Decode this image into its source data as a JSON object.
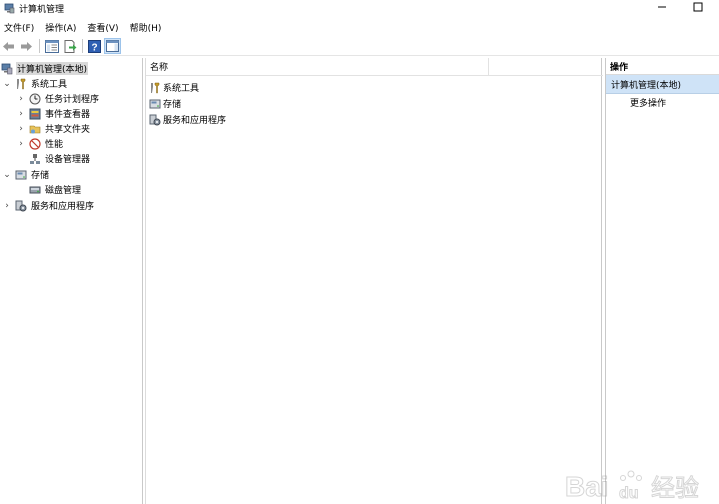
{
  "window": {
    "title": "计算机管理",
    "minimize_glyph": "—",
    "maximize_glyph": "☐"
  },
  "menu": {
    "items": [
      {
        "label": "文件(F)"
      },
      {
        "label": "操作(A)"
      },
      {
        "label": "查看(V)"
      },
      {
        "label": "帮助(H)"
      }
    ]
  },
  "toolbar": {
    "icons": [
      "back-arrow-icon",
      "forward-arrow-icon",
      "show-console-tree-icon",
      "export-list-icon",
      "help-icon",
      "show-action-pane-icon"
    ]
  },
  "tree": {
    "root": {
      "label": "计算机管理(本地)",
      "icon": "computer-management-icon"
    },
    "system_tools": {
      "label": "系统工具",
      "chevron": "⌄",
      "icon": "tools-icon"
    },
    "task_scheduler": {
      "label": "任务计划程序",
      "chevron": "›",
      "icon": "clock-icon"
    },
    "event_viewer": {
      "label": "事件查看器",
      "chevron": "›",
      "icon": "event-viewer-icon"
    },
    "shared_folders": {
      "label": "共享文件夹",
      "chevron": "›",
      "icon": "shared-folder-icon"
    },
    "performance": {
      "label": "性能",
      "chevron": "›",
      "icon": "performance-icon"
    },
    "device_manager": {
      "label": "设备管理器",
      "icon": "device-manager-icon"
    },
    "storage": {
      "label": "存储",
      "chevron": "⌄",
      "icon": "storage-icon"
    },
    "disk_management": {
      "label": "磁盘管理",
      "icon": "disk-icon"
    },
    "services_apps": {
      "label": "服务和应用程序",
      "chevron": "›",
      "icon": "services-icon"
    }
  },
  "center": {
    "column_header": "名称",
    "rows": [
      {
        "label": "系统工具",
        "icon": "tools-icon"
      },
      {
        "label": "存储",
        "icon": "storage-icon"
      },
      {
        "label": "服务和应用程序",
        "icon": "services-icon"
      }
    ]
  },
  "actions": {
    "header": "操作",
    "section": "计算机管理(本地)",
    "items": [
      {
        "label": "更多操作"
      }
    ],
    "section_color": "#cfe3f7"
  },
  "watermark": {
    "text_baidu": "Bai",
    "text_du": "du",
    "text_jingyan": "经验"
  }
}
